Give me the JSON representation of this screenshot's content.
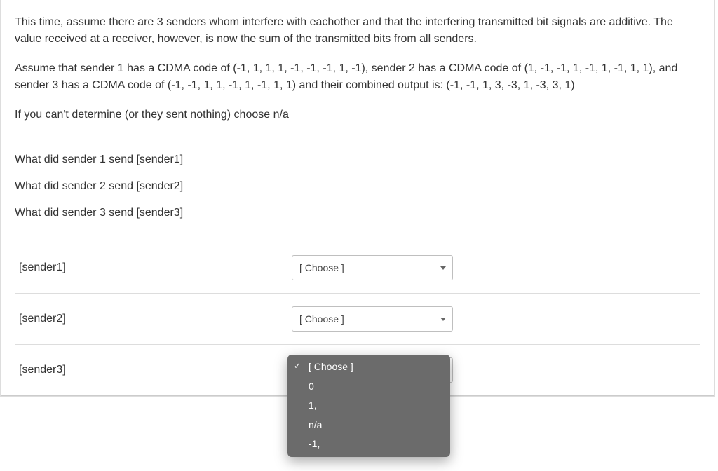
{
  "prompt": {
    "p1": "This time, assume there are 3 senders whom interfere with eachother and that the interfering transmitted bit signals are additive. The value received at a receiver, however, is now the sum of the transmitted bits from all senders.",
    "p2": "Assume that sender 1 has a CDMA code of (-1, 1, 1, 1, -1, -1, -1, 1, -1), sender 2 has a CDMA code of (1, -1, -1, 1, -1, 1, -1, 1, 1), and sender 3 has a CDMA code of (-1, -1, 1, 1, -1, 1, -1, 1, 1) and their combined output is: (-1, -1, 1, 3, -3, 1, -3, 3, 1)",
    "p3": "If you can't determine (or they sent nothing) choose n/a"
  },
  "questions": {
    "q1": "What did sender 1 send [sender1]",
    "q2": "What did sender 2 send [sender2]",
    "q3": "What did sender 3 send [sender3]"
  },
  "rows": {
    "sender1": {
      "label": "[sender1]",
      "placeholder": "[ Choose ]"
    },
    "sender2": {
      "label": "[sender2]",
      "placeholder": "[ Choose ]"
    },
    "sender3": {
      "label": "[sender3]"
    }
  },
  "dropdown": {
    "options": {
      "o0": "[ Choose ]",
      "o1": "0",
      "o2": "1,",
      "o3": "n/a",
      "o4": "-1,"
    },
    "selected_index": 0
  }
}
